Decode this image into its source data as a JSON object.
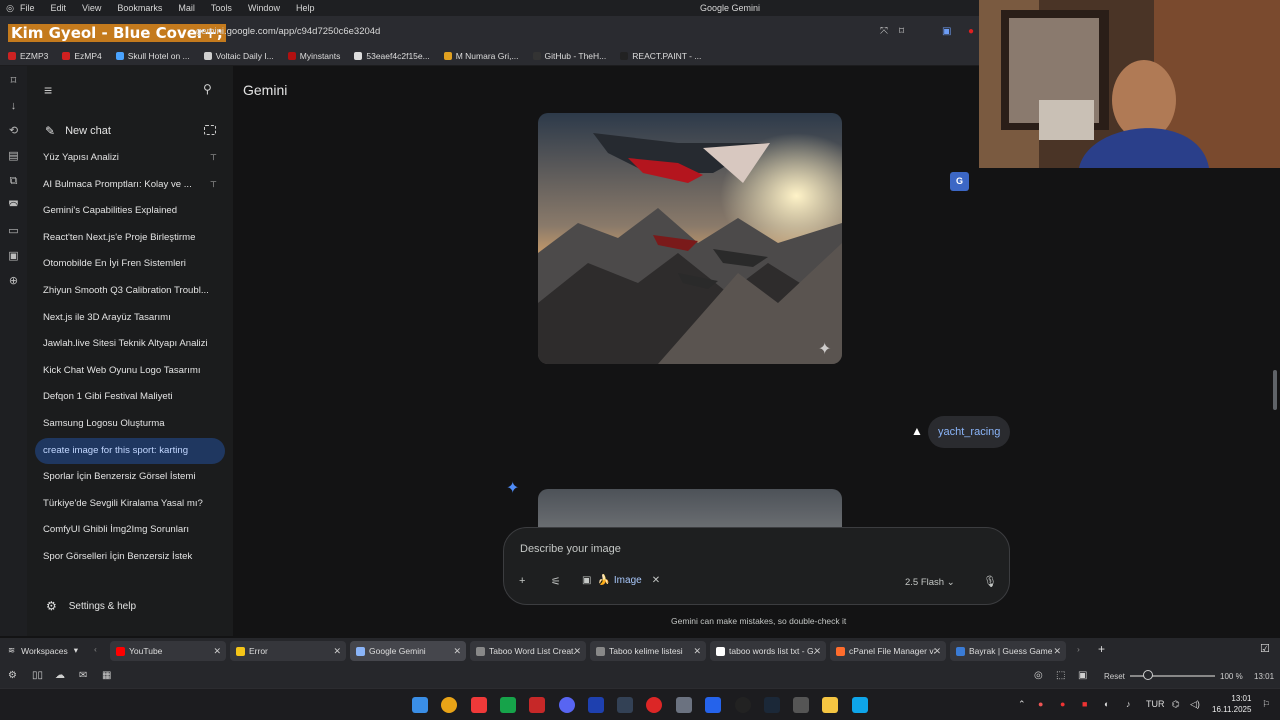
{
  "menubar": {
    "items": [
      "File",
      "Edit",
      "View",
      "Bookmarks",
      "Mail",
      "Tools",
      "Window",
      "Help"
    ],
    "window_title": "Google Gemini"
  },
  "address_bar": {
    "media_overlay": "Kim Gyeol - Blue Cover+;",
    "url": "gemini.google.com/app/c94d7250c6e3204d"
  },
  "bookmarks": [
    {
      "label": "EZMP3",
      "color": "#cc2222"
    },
    {
      "label": "EzMP4",
      "color": "#d02020"
    },
    {
      "label": "Skull Hotel on ...",
      "color": "#4aa3ff"
    },
    {
      "label": "Voltaic Daily I...",
      "color": "#cfcfcf"
    },
    {
      "label": "Myinstants",
      "color": "#b01010"
    },
    {
      "label": "53eaef4c2f15e...",
      "color": "#dddddd"
    },
    {
      "label": "M Numara Gri,...",
      "color": "#e0a020"
    },
    {
      "label": "GitHub - TheH...",
      "color": "#333333"
    },
    {
      "label": "REACT.PAINT - ...",
      "color": "#222222"
    }
  ],
  "gemini": {
    "brand": "Gemini",
    "new_chat": "New chat",
    "settings": "Settings & help",
    "recent": [
      {
        "title": "Yüz Yapısı Analizi",
        "pinned": true
      },
      {
        "title": "AI Bulmaca Promptları: Kolay ve ...",
        "pinned": true
      },
      {
        "title": "Gemini's Capabilities Explained"
      },
      {
        "title": "React'ten Next.js'e Proje Birleştirme"
      },
      {
        "title": "Otomobilde En İyi Fren Sistemleri"
      },
      {
        "title": "Zhiyun Smooth Q3 Calibration Troubl..."
      },
      {
        "title": "Next.js ile 3D Arayüz Tasarımı"
      },
      {
        "title": "Jawlah.live Sitesi Teknik Altyapı Analizi"
      },
      {
        "title": "Kick Chat Web Oyunu Logo Tasarımı"
      },
      {
        "title": "Defqon 1 Gibi Festival Maliyeti"
      },
      {
        "title": "Samsung Logosu Oluşturma"
      },
      {
        "title": "create image for this sport: karting",
        "active": true
      },
      {
        "title": "Sporlar İçin Benzersiz Görsel İstemi"
      },
      {
        "title": "Türkiye'de Sevgili Kiralama Yasal mı?"
      },
      {
        "title": "ComfyUI Ghibli İmg2Img Sorunları"
      },
      {
        "title": "Spor Görselleri İçin Benzersiz İstek"
      }
    ],
    "user_message": "yacht_racing",
    "input_placeholder": "Describe your image",
    "image_chip": "Image",
    "model": "2.5 Flash",
    "disclaimer": "Gemini can make mistakes, so double-check it"
  },
  "tabs": {
    "workspaces": "Workspaces",
    "items": [
      {
        "label": "YouTube",
        "color": "#ff0000"
      },
      {
        "label": "Error",
        "color": "#f5c518"
      },
      {
        "label": "Google Gemini",
        "color": "#8ab4f8",
        "active": true
      },
      {
        "label": "Taboo Word List Creat...",
        "color": "#888888"
      },
      {
        "label": "Taboo kelime listesi",
        "color": "#888888"
      },
      {
        "label": "taboo words list txt - G...",
        "color": "#ffffff"
      },
      {
        "label": "cPanel File Manager v3",
        "color": "#ff6c2c"
      },
      {
        "label": "Bayrak | Guess Game",
        "color": "#3a7bd5"
      }
    ]
  },
  "status": {
    "reset": "Reset",
    "zoom": "100 %",
    "zoom_value": 100,
    "status_time": "13:01"
  },
  "taskbar": {
    "language": "TUR",
    "time": "13:01",
    "date": "16.11.2025"
  }
}
